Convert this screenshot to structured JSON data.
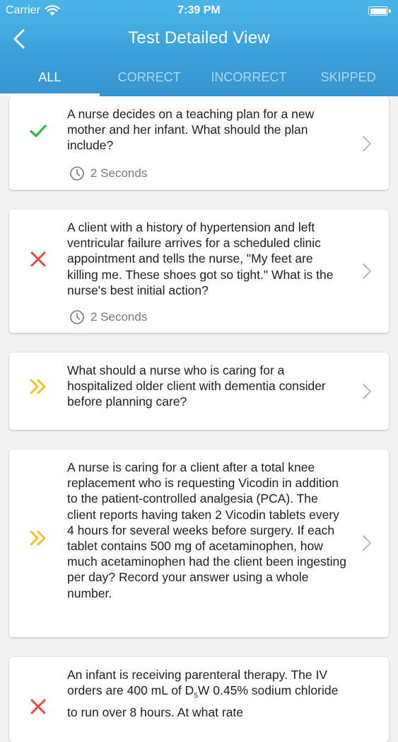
{
  "status_bar": {
    "carrier": "Carrier",
    "time": "7:39 PM"
  },
  "header": {
    "title": "Test Detailed View"
  },
  "tabs": [
    {
      "label": "ALL",
      "active": true
    },
    {
      "label": "CORRECT",
      "active": false
    },
    {
      "label": "INCORRECT",
      "active": false
    },
    {
      "label": "SKIPPED",
      "active": false
    }
  ],
  "colors": {
    "header_top": "#49b5e7",
    "header_bottom": "#3695d2",
    "correct": "#3cb54a",
    "incorrect": "#e84545",
    "skipped": "#f3c017"
  },
  "questions": [
    {
      "status": "correct",
      "icon": "check-icon",
      "text": "A nurse decides on a teaching plan for a new mother and her infant. What should the plan include?",
      "time": "2 Seconds"
    },
    {
      "status": "incorrect",
      "icon": "cross-icon",
      "text": "A client with a history of hypertension and left ventricular failure arrives for a scheduled clinic appointment and tells the nurse, \"My feet are killing me. These shoes got so tight.\" What is the nurse's best initial action?",
      "time": "2 Seconds"
    },
    {
      "status": "skipped",
      "icon": "double-chevron-icon",
      "text": "What should a nurse who is caring for a hospitalized older client with dementia consider before planning care?"
    },
    {
      "status": "skipped",
      "icon": "double-chevron-icon",
      "text": "A nurse is caring for a client after a total knee replacement who is requesting Vicodin in addition to the patient-controlled analgesia (PCA). The client reports having taken 2 Vicodin tablets every 4 hours for several weeks before surgery. If each tablet contains 500 mg of acetaminophen, how much acetaminophen had the client been ingesting per day? Record your answer using a whole number."
    },
    {
      "status": "incorrect",
      "icon": "cross-icon",
      "text_parts": [
        "An infant is receiving parenteral therapy. The IV orders are 400 mL of D",
        "5",
        "W 0.45% sodium chloride to run over 8 hours. At what rate"
      ]
    }
  ]
}
